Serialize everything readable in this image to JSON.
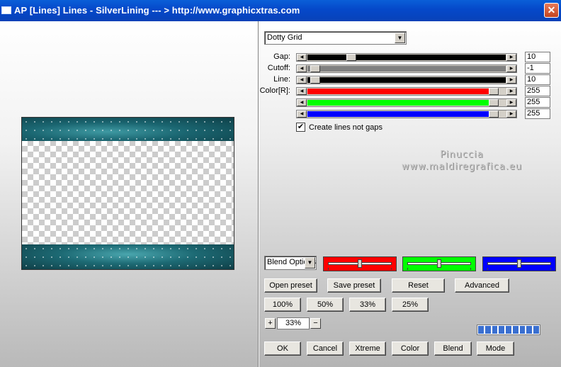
{
  "window": {
    "title": "AP [Lines]  Lines - SilverLining      --- > http://www.graphicxtras.com",
    "close_label": "✕"
  },
  "preset_select": {
    "value": "Dotty Grid",
    "arrow": "▼"
  },
  "params": [
    {
      "label": "Gap:",
      "value": "10",
      "fill": "#000000",
      "fill_track_percent": 100,
      "thumb_percent": 22
    },
    {
      "label": "Cutoff:",
      "value": "-1",
      "fill": "#808080",
      "fill_track_percent": 100,
      "thumb_percent": 4
    },
    {
      "label": "Line:",
      "value": "10",
      "fill": "#000000",
      "fill_track_percent": 100,
      "thumb_percent": 4
    },
    {
      "label": "Color[R]:",
      "value": "255",
      "fill": "#ff0000",
      "fill_track_percent": 94,
      "thumb_percent": 94
    },
    {
      "label": "",
      "value": "255",
      "fill": "#00ff00",
      "fill_track_percent": 94,
      "thumb_percent": 94
    },
    {
      "label": "",
      "value": "255",
      "fill": "#0000ff",
      "fill_track_percent": 94,
      "thumb_percent": 94
    }
  ],
  "checkbox": {
    "checked": true,
    "mark": "✔",
    "label": "Create lines not gaps"
  },
  "watermark": {
    "line1": "Pinuccia",
    "line2": "www.maldiregrafica.eu"
  },
  "blend_select": {
    "value": "Blend Options",
    "arrow": "▼"
  },
  "color_sliders": [
    {
      "color": "#ff0000",
      "level_percent": 50
    },
    {
      "color": "#00ff00",
      "level_percent": 50
    },
    {
      "color": "#0000ff",
      "level_percent": 50
    }
  ],
  "preset_buttons": [
    "Open preset",
    "Save preset",
    "Reset",
    "Advanced"
  ],
  "zoom_buttons": [
    "100%",
    "50%",
    "33%",
    "25%"
  ],
  "zoom": {
    "plus": "+",
    "minus": "−",
    "value": "33%"
  },
  "progress_segments": 9,
  "bottom_buttons": [
    "OK",
    "Cancel",
    "Xtreme",
    "Color",
    "Blend",
    "Mode"
  ]
}
